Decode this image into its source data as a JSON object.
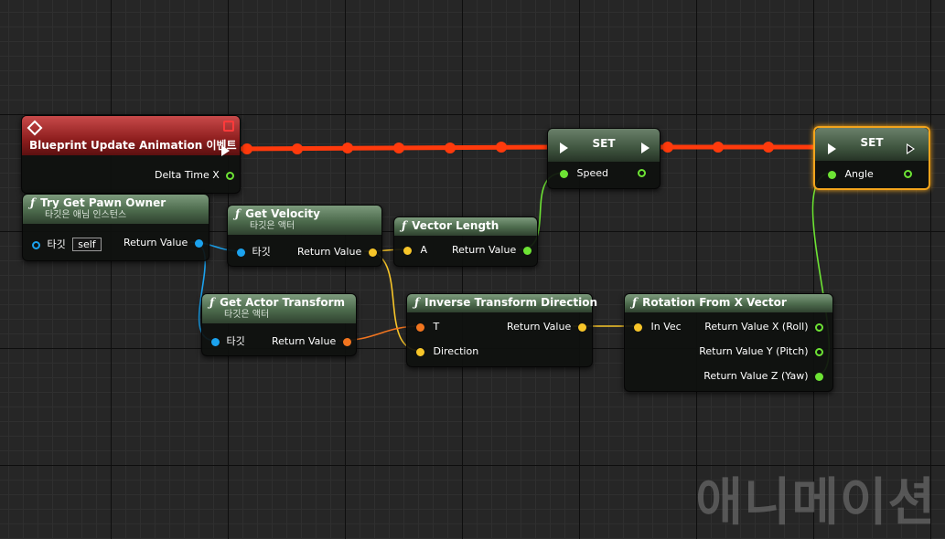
{
  "colors": {
    "exec": "#ff3a0c",
    "float": "#6de334",
    "vector": "#f7c529",
    "object": "#1ba2ee",
    "transform": "#f2751f",
    "selected_border": "#f3a41c"
  },
  "nodes": {
    "event": {
      "title": "Blueprint Update Animation 이벤트",
      "out_pin": "Delta Time X"
    },
    "pawn_owner": {
      "title": "Try Get Pawn Owner",
      "subtitle": "타깃은 애님 인스턴스",
      "in_pin": "타깃",
      "in_default": "self",
      "out_pin": "Return Value"
    },
    "velocity": {
      "title": "Get Velocity",
      "subtitle": "타깃은 액터",
      "in_pin": "타깃",
      "out_pin": "Return Value"
    },
    "vector_length": {
      "title": "Vector Length",
      "in_pin": "A",
      "out_pin": "Return Value"
    },
    "set_speed": {
      "title": "SET",
      "pin": "Speed"
    },
    "set_angle": {
      "title": "SET",
      "pin": "Angle"
    },
    "actor_transform": {
      "title": "Get Actor Transform",
      "subtitle": "타깃은 액터",
      "in_pin": "타깃",
      "out_pin": "Return Value"
    },
    "inverse_dir": {
      "title": "Inverse Transform Direction",
      "in_pin_t": "T",
      "in_pin_dir": "Direction",
      "out_pin": "Return Value"
    },
    "rot_from_x": {
      "title": "Rotation From X Vector",
      "in_pin": "In Vec",
      "out_x": "Return Value X (Roll)",
      "out_y": "Return Value Y (Pitch)",
      "out_z": "Return Value Z (Yaw)"
    }
  },
  "watermark": "애니메이션"
}
